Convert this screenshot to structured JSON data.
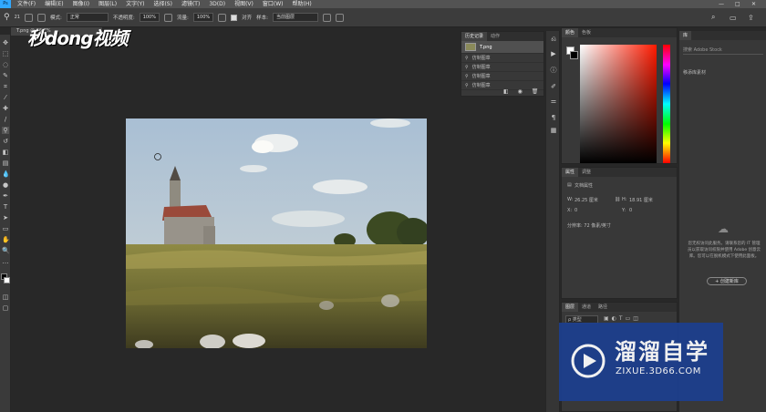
{
  "menu": {
    "items": [
      "文件(F)",
      "编辑(E)",
      "图像(I)",
      "图层(L)",
      "文字(Y)",
      "选择(S)",
      "滤镜(T)",
      "3D(D)",
      "视图(V)",
      "窗口(W)",
      "帮助(H)"
    ],
    "ps_label": "Ps"
  },
  "options": {
    "mode_label": "模式:",
    "mode_value": "正常",
    "opacity_label": "不透明度:",
    "opacity_value": "100%",
    "flow_label": "流量:",
    "flow_value": "100%",
    "align_label": "对齐",
    "sample_label": "样本:",
    "sample_value": "当前图层",
    "brush_size": "21"
  },
  "document": {
    "tab": "T.png @ 66.7%"
  },
  "watermark": {
    "logo": "秒dong视频",
    "badge_title": "溜溜自学",
    "badge_sub": "ZIXUE.3D66.COM"
  },
  "history": {
    "tabs": [
      "历史记录",
      "动作"
    ],
    "snapshot": "T.png",
    "rows": [
      "仿制图章",
      "仿制图章",
      "仿制图章",
      "仿制图章"
    ]
  },
  "color_panel": {
    "tabs": [
      "颜色",
      "色板"
    ]
  },
  "properties": {
    "tabs": [
      "属性",
      "调整"
    ],
    "section": "文档属性",
    "w_label": "W:",
    "w_value": "26.25 厘米",
    "h_label": "H:",
    "h_value": "18.91 厘米",
    "x_label": "X:",
    "x_value": "0",
    "y_label": "Y:",
    "y_value": "0",
    "resolution": "分辨率: 72 像素/英寸"
  },
  "layers": {
    "tabs": [
      "图层",
      "通道",
      "路径"
    ],
    "search": "ρ 类型"
  },
  "libraries": {
    "tab": "库",
    "search_placeholder": "搜索 Adobe Stock",
    "dropdown": "移添库素材",
    "message": "您无权访问此服务。请联系您的 IT 管理员以获取访问权限并使用 Adobe 创意云库。您可以在脱机模式下使用此面板。",
    "button": "+ 创建新库"
  },
  "colors": {
    "accent": "#31a8ff",
    "badge": "#1d3f8f"
  }
}
